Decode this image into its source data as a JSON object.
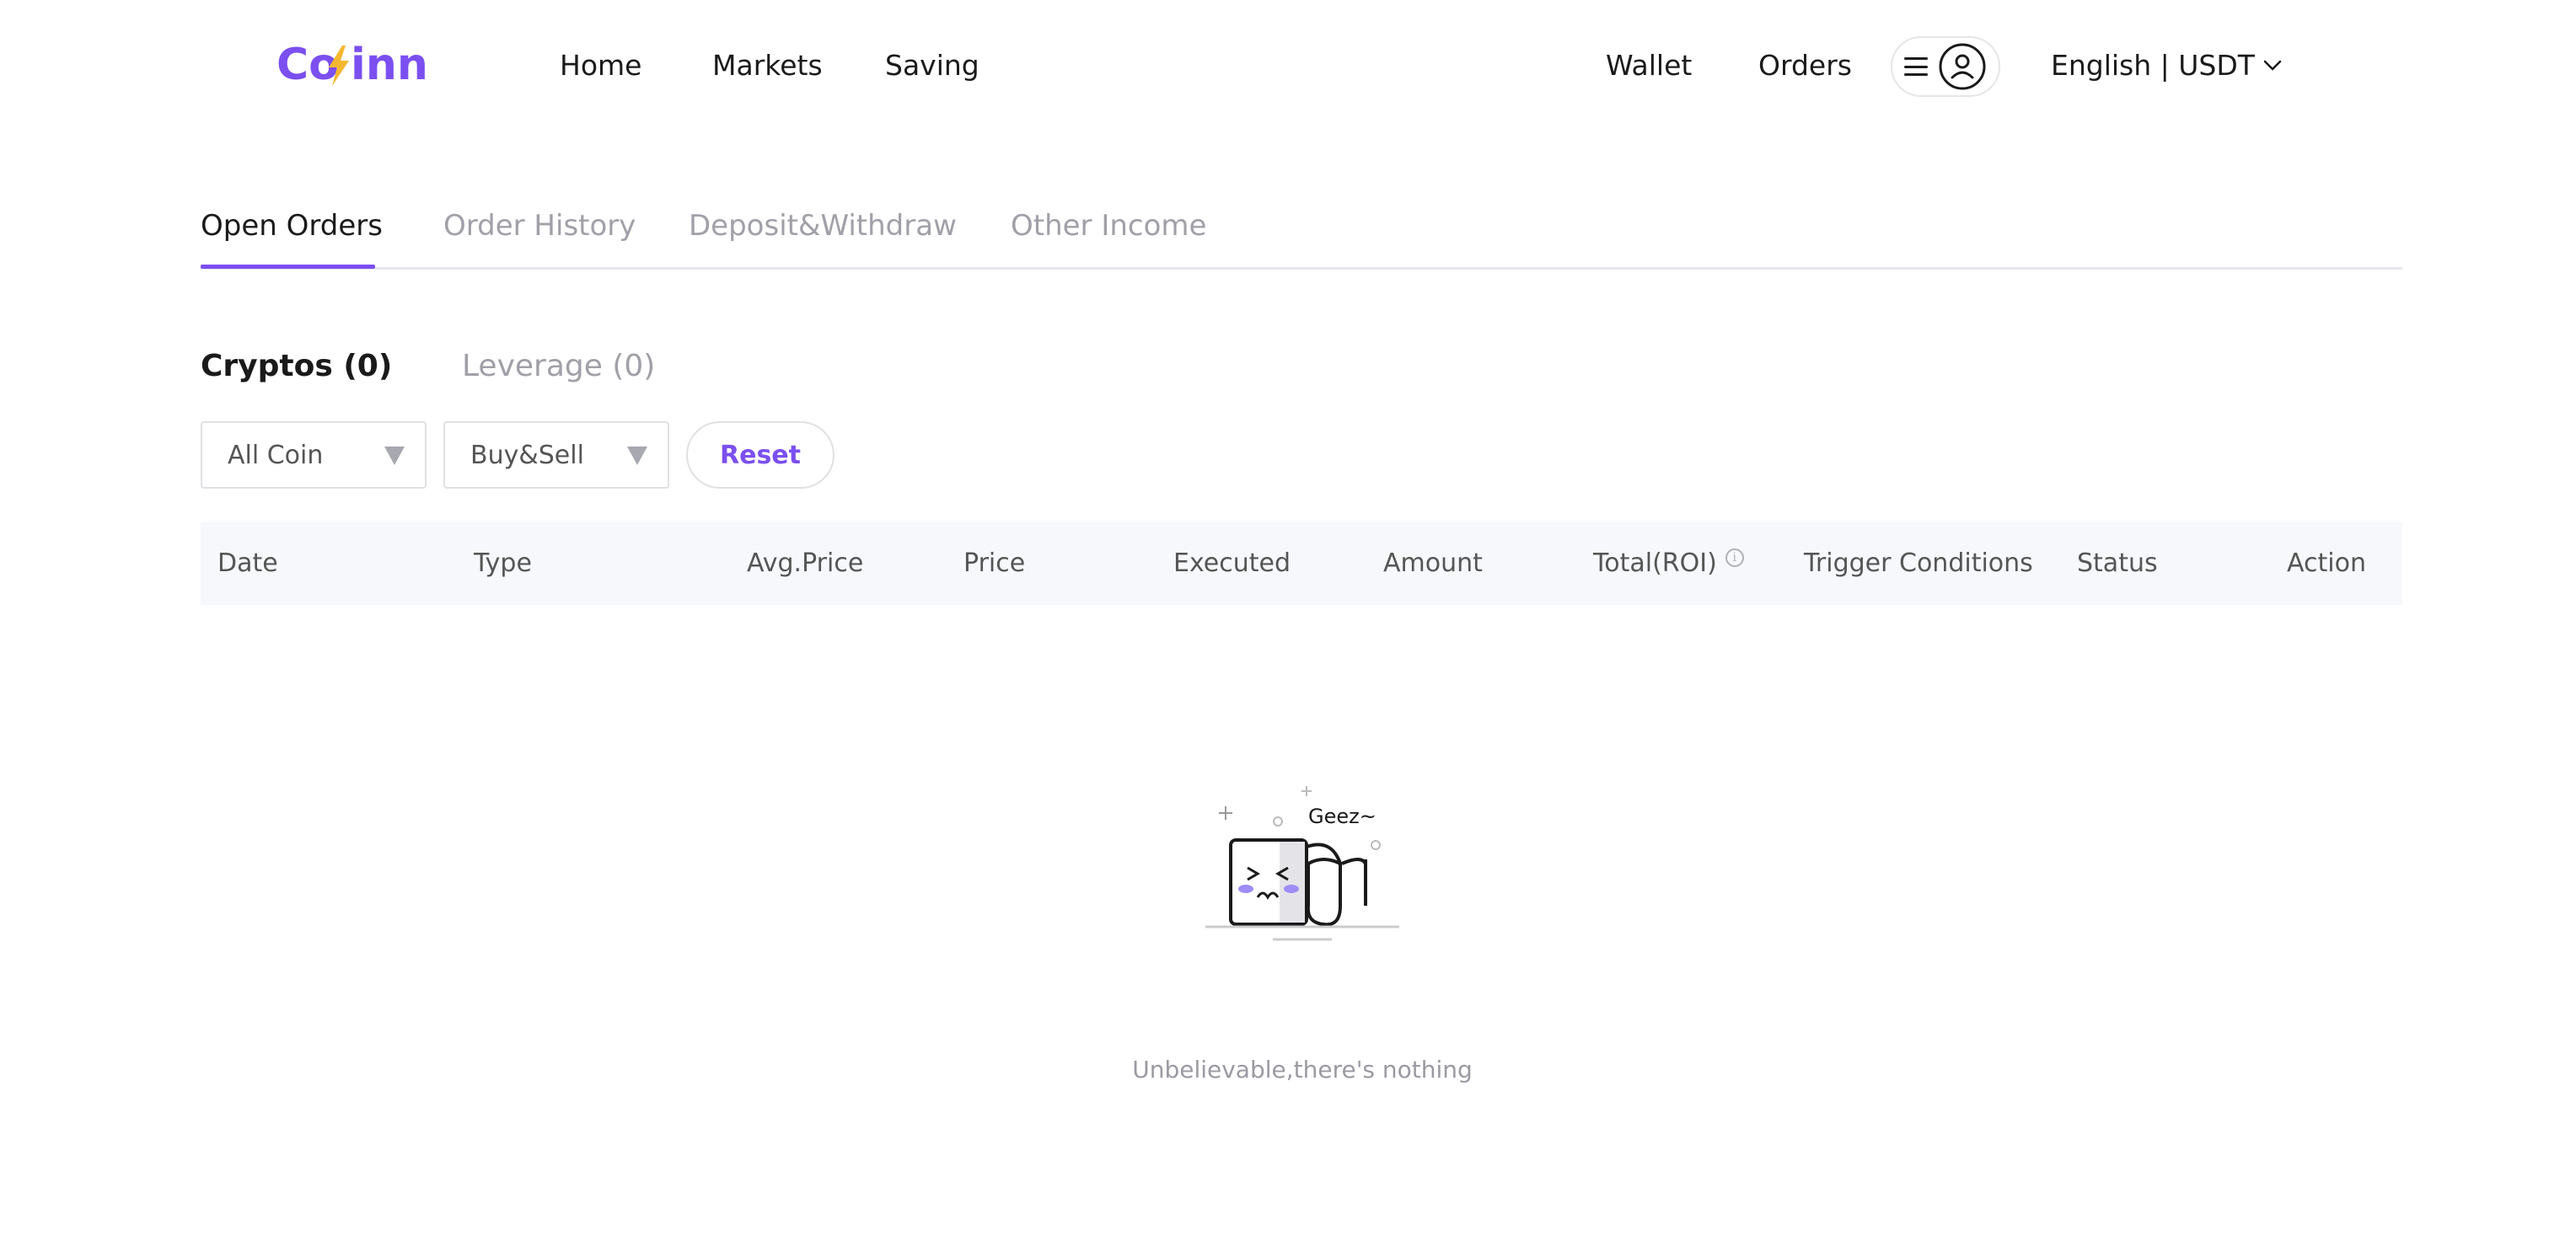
{
  "brand": {
    "logo_text": "Coninn",
    "primary_color": "#7b4ff0",
    "accent_color": "#f5b731"
  },
  "header": {
    "nav": [
      "Home",
      "Markets",
      "Saving"
    ],
    "wallet": "Wallet",
    "orders": "Orders",
    "language": "English | USDT"
  },
  "tabs": {
    "items": [
      "Open Orders",
      "Order History",
      "Deposit&Withdraw",
      "Other Income"
    ],
    "active": "Open Orders"
  },
  "subtabs": {
    "items": [
      "Cryptos (0)",
      "Leverage (0)"
    ],
    "active": "Cryptos (0)"
  },
  "filters": {
    "coin": "All Coin",
    "side": "Buy&Sell",
    "reset": "Reset"
  },
  "table": {
    "columns": [
      "Date",
      "Type",
      "Avg.Price",
      "Price",
      "Executed",
      "Amount",
      "Total(ROI)",
      "Trigger Conditions",
      "Status",
      "Action"
    ]
  },
  "empty_state": {
    "illustration_text": "Geez~",
    "message": "Unbelievable,there's nothing"
  }
}
